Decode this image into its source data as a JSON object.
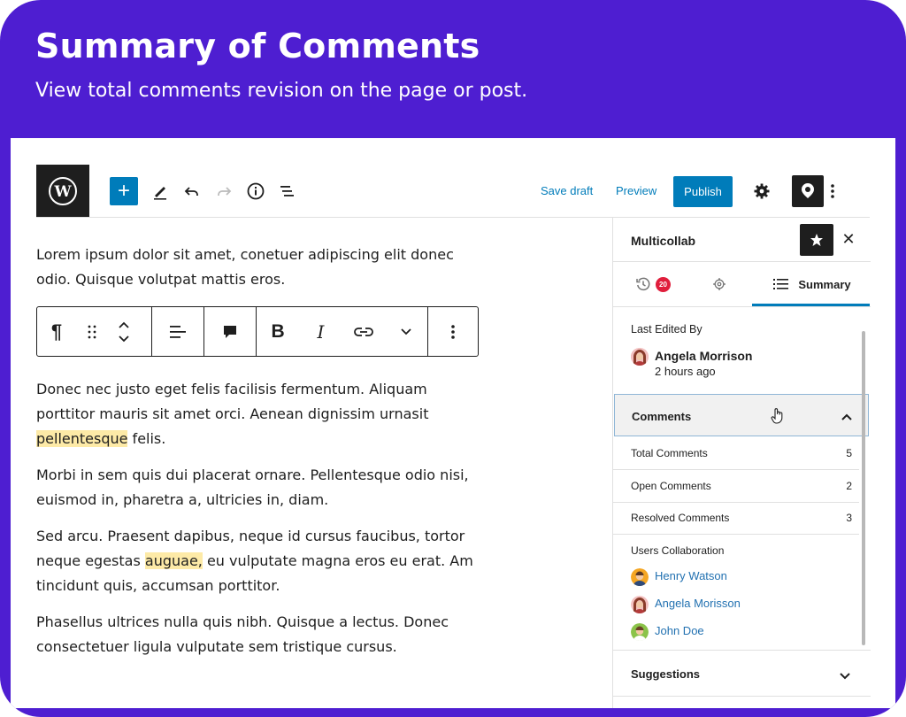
{
  "hero": {
    "title": "Summary of Comments",
    "subtitle": "View total comments revision on the page or post."
  },
  "toolbar": {
    "save_draft_label": "Save draft",
    "preview_label": "Preview",
    "publish_label": "Publish",
    "icons": [
      "wordpress-icon",
      "plus-icon",
      "pencil-icon",
      "undo-icon",
      "redo-icon",
      "info-icon",
      "list-view-icon",
      "gear-icon",
      "multicollab-icon",
      "more-vertical-icon"
    ]
  },
  "editor": {
    "p1": "Lorem ipsum dolor sit amet, conetuer adipiscing elit donec odio. Quisque volutpat mattis eros.",
    "p2_before": "Donec nec justo eget felis facilisis fermentum. Aliquam porttitor mauris sit amet orci. Aenean dignissim urnasit ",
    "p2_highlight": "pellentesque",
    "p2_after": " felis.",
    "p3": "Morbi in sem quis dui placerat ornare. Pellentesque odio nisi, euismod in, pharetra a, ultricies in, diam.",
    "p4_before": "Sed arcu. Praesent dapibus, neque id cursus faucibus, tortor neque egestas ",
    "p4_highlight": "auguae,",
    "p4_after": " eu vulputate magna eros eu erat. Am tincidunt quis, accumsan porttitor.",
    "p5": "Phasellus ultrices nulla quis nibh. Quisque a lectus. Donec consectetuer ligula vulputate sem tristique cursus.",
    "block_toolbar": {
      "paragraph_symbol": "¶",
      "bold": "B",
      "italic": "I"
    },
    "highlight_color": "#fdeaa7"
  },
  "sidebar": {
    "title": "Multicollab",
    "tabs": {
      "activity_badge": "20",
      "summary_label": "Summary"
    },
    "last_edited": {
      "heading": "Last Edited By",
      "name": "Angela Morrison",
      "time": "2 hours ago"
    },
    "comments": {
      "heading": "Comments",
      "rows": [
        {
          "label": "Total Comments",
          "value": "5"
        },
        {
          "label": "Open Comments",
          "value": "2"
        },
        {
          "label": "Resolved Comments",
          "value": "3"
        }
      ],
      "users_heading": "Users Collaboration",
      "users": [
        "Henry Watson",
        "Angela Morisson",
        "John Doe"
      ]
    },
    "suggestions_heading": "Suggestions"
  },
  "colors": {
    "frame": "#4e1ed1",
    "accent": "#007cba",
    "badge": "#e01e3c",
    "link": "#2271b1"
  }
}
